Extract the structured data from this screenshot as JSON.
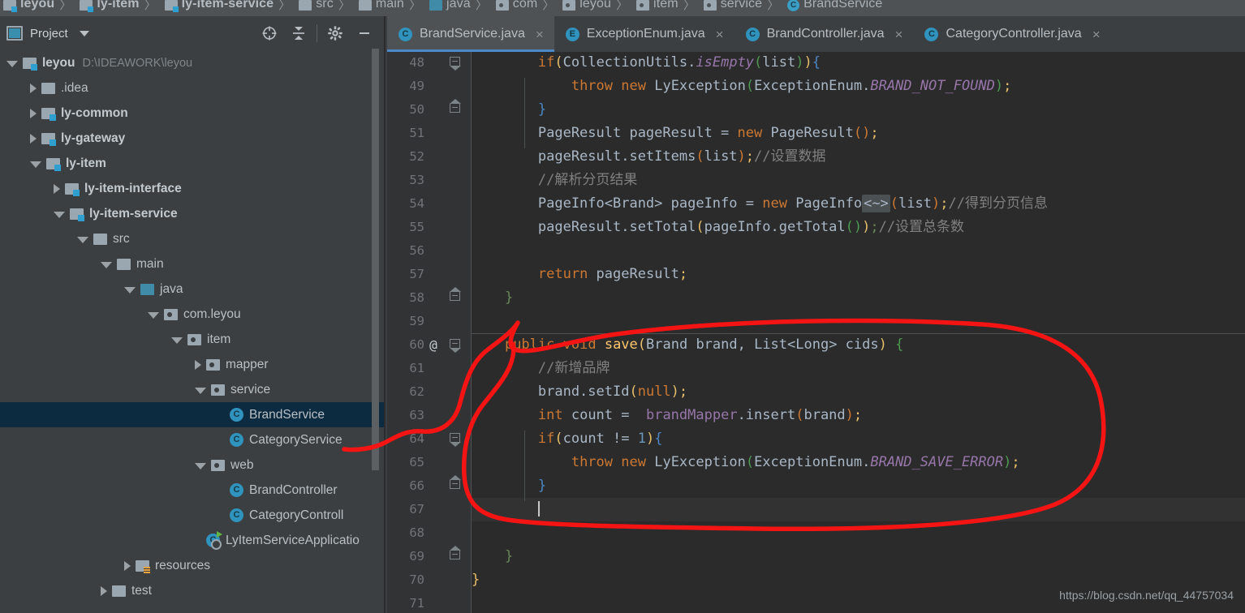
{
  "breadcrumb": [
    {
      "label": "leyou",
      "icon": "module-folder-icon",
      "bold": true
    },
    {
      "label": "ly-item",
      "icon": "module-folder-icon",
      "bold": true
    },
    {
      "label": "ly-item-service",
      "icon": "module-folder-icon",
      "bold": true
    },
    {
      "label": "src",
      "icon": "folder-icon",
      "bold": false
    },
    {
      "label": "main",
      "icon": "folder-icon",
      "bold": false
    },
    {
      "label": "java",
      "icon": "source-root-icon",
      "bold": false
    },
    {
      "label": "com",
      "icon": "package-icon",
      "bold": false
    },
    {
      "label": "leyou",
      "icon": "package-icon",
      "bold": false
    },
    {
      "label": "item",
      "icon": "package-icon",
      "bold": false
    },
    {
      "label": "service",
      "icon": "package-icon",
      "bold": false
    },
    {
      "label": "BrandService",
      "icon": "class-icon",
      "bold": false
    }
  ],
  "project_panel": {
    "title": "Project",
    "dropdown_caret": "chevron-down-icon",
    "tools": [
      {
        "name": "locate-icon",
        "tooltip": "Select Opened File"
      },
      {
        "name": "collapse-all-icon",
        "tooltip": "Collapse All"
      },
      {
        "name": "gear-icon",
        "tooltip": "Settings"
      },
      {
        "name": "minimize-icon",
        "tooltip": "Hide"
      }
    ],
    "tree": [
      {
        "indent": 0,
        "arrow": "open",
        "icon": "module-folder-icon",
        "label": "leyou",
        "secondary": "D:\\IDEAWORK\\leyou",
        "bold": true,
        "selected": false
      },
      {
        "indent": 1,
        "arrow": "closed",
        "icon": "folder-icon",
        "label": ".idea",
        "secondary": "",
        "bold": false,
        "selected": false
      },
      {
        "indent": 1,
        "arrow": "closed",
        "icon": "module-folder-icon",
        "label": "ly-common",
        "secondary": "",
        "bold": true,
        "selected": false
      },
      {
        "indent": 1,
        "arrow": "closed",
        "icon": "module-folder-icon",
        "label": "ly-gateway",
        "secondary": "",
        "bold": true,
        "selected": false
      },
      {
        "indent": 1,
        "arrow": "open",
        "icon": "module-folder-icon",
        "label": "ly-item",
        "secondary": "",
        "bold": true,
        "selected": false
      },
      {
        "indent": 2,
        "arrow": "closed",
        "icon": "module-folder-icon",
        "label": "ly-item-interface",
        "secondary": "",
        "bold": true,
        "selected": false
      },
      {
        "indent": 2,
        "arrow": "open",
        "icon": "module-folder-icon",
        "label": "ly-item-service",
        "secondary": "",
        "bold": true,
        "selected": false
      },
      {
        "indent": 3,
        "arrow": "open",
        "icon": "folder-icon",
        "label": "src",
        "secondary": "",
        "bold": false,
        "selected": false
      },
      {
        "indent": 4,
        "arrow": "open",
        "icon": "folder-icon",
        "label": "main",
        "secondary": "",
        "bold": false,
        "selected": false
      },
      {
        "indent": 5,
        "arrow": "open",
        "icon": "source-root-icon",
        "label": "java",
        "secondary": "",
        "bold": false,
        "selected": false
      },
      {
        "indent": 6,
        "arrow": "open",
        "icon": "package-icon",
        "label": "com.leyou",
        "secondary": "",
        "bold": false,
        "selected": false
      },
      {
        "indent": 7,
        "arrow": "open",
        "icon": "package-icon",
        "label": "item",
        "secondary": "",
        "bold": false,
        "selected": false
      },
      {
        "indent": 8,
        "arrow": "closed",
        "icon": "package-icon",
        "label": "mapper",
        "secondary": "",
        "bold": false,
        "selected": false
      },
      {
        "indent": 8,
        "arrow": "open",
        "icon": "package-icon",
        "label": "service",
        "secondary": "",
        "bold": false,
        "selected": false
      },
      {
        "indent": 9,
        "arrow": "none",
        "icon": "class-icon",
        "label": "BrandService",
        "secondary": "",
        "bold": false,
        "selected": true
      },
      {
        "indent": 9,
        "arrow": "none",
        "icon": "class-icon",
        "label": "CategoryService",
        "secondary": "",
        "bold": false,
        "selected": false
      },
      {
        "indent": 8,
        "arrow": "open",
        "icon": "package-icon",
        "label": "web",
        "secondary": "",
        "bold": false,
        "selected": false
      },
      {
        "indent": 9,
        "arrow": "none",
        "icon": "class-icon",
        "label": "BrandController",
        "secondary": "",
        "bold": false,
        "selected": false
      },
      {
        "indent": 9,
        "arrow": "none",
        "icon": "class-icon",
        "label": "CategoryControll",
        "secondary": "",
        "bold": false,
        "selected": false
      },
      {
        "indent": 8,
        "arrow": "none",
        "icon": "runnable-class-icon",
        "label": "LyItemServiceApplicatio",
        "secondary": "",
        "bold": false,
        "selected": false
      },
      {
        "indent": 5,
        "arrow": "closed",
        "icon": "resources-folder-icon",
        "label": "resources",
        "secondary": "",
        "bold": false,
        "selected": false
      },
      {
        "indent": 4,
        "arrow": "closed",
        "icon": "folder-icon",
        "label": "test",
        "secondary": "",
        "bold": false,
        "selected": false
      }
    ]
  },
  "editor_tabs": [
    {
      "label": "BrandService.java",
      "icon": "class-icon",
      "glyph": "C",
      "active": true,
      "close": "close-icon"
    },
    {
      "label": "ExceptionEnum.java",
      "icon": "enum-icon",
      "glyph": "E",
      "active": false,
      "close": "close-icon"
    },
    {
      "label": "BrandController.java",
      "icon": "class-icon",
      "glyph": "C",
      "active": false,
      "close": "close-icon"
    },
    {
      "label": "CategoryController.java",
      "icon": "class-icon",
      "glyph": "C",
      "active": false,
      "close": "close-icon"
    }
  ],
  "editor": {
    "first_line_number": 48,
    "last_line_number": 71,
    "current_line": 67,
    "annotation_gutter_line": 60,
    "annotation_gutter_glyph": "@",
    "lines": [
      {
        "n": 48,
        "text": "        if(CollectionUtils.isEmpty(list)){"
      },
      {
        "n": 49,
        "text": "            throw new LyException(ExceptionEnum.BRAND_NOT_FOUND);"
      },
      {
        "n": 50,
        "text": "        }"
      },
      {
        "n": 51,
        "text": "        PageResult pageResult = new PageResult();"
      },
      {
        "n": 52,
        "text": "        pageResult.setItems(list);//设置数据"
      },
      {
        "n": 53,
        "text": "        //解析分页结果"
      },
      {
        "n": 54,
        "text": "        PageInfo<Brand> pageInfo = new PageInfo<~>(list);//得到分页信息"
      },
      {
        "n": 55,
        "text": "        pageResult.setTotal(pageInfo.getTotal());//设置总条数"
      },
      {
        "n": 56,
        "text": ""
      },
      {
        "n": 57,
        "text": "        return pageResult;"
      },
      {
        "n": 58,
        "text": "    }"
      },
      {
        "n": 59,
        "text": ""
      },
      {
        "n": 60,
        "text": "    public void save(Brand brand, List<Long> cids) {"
      },
      {
        "n": 61,
        "text": "        //新增品牌"
      },
      {
        "n": 62,
        "text": "        brand.setId(null);"
      },
      {
        "n": 63,
        "text": "        int count =  brandMapper.insert(brand);"
      },
      {
        "n": 64,
        "text": "        if(count != 1){"
      },
      {
        "n": 65,
        "text": "            throw new LyException(ExceptionEnum.BRAND_SAVE_ERROR);"
      },
      {
        "n": 66,
        "text": "        }"
      },
      {
        "n": 67,
        "text": ""
      },
      {
        "n": 68,
        "text": ""
      },
      {
        "n": 69,
        "text": "    }"
      },
      {
        "n": 70,
        "text": "}"
      },
      {
        "n": 71,
        "text": ""
      }
    ]
  },
  "watermark": "https://blog.csdn.net/qq_44757034",
  "colors": {
    "accent": "#4a88c7",
    "annotation_red": "#f41414",
    "selection": "#0d2b40",
    "editor_bg": "#2b2b2b",
    "panel_bg": "#3c3f41",
    "keyword": "#cc7832",
    "comment": "#808080",
    "static_field": "#9876aa",
    "method": "#ffc66d",
    "number": "#6897bb"
  }
}
